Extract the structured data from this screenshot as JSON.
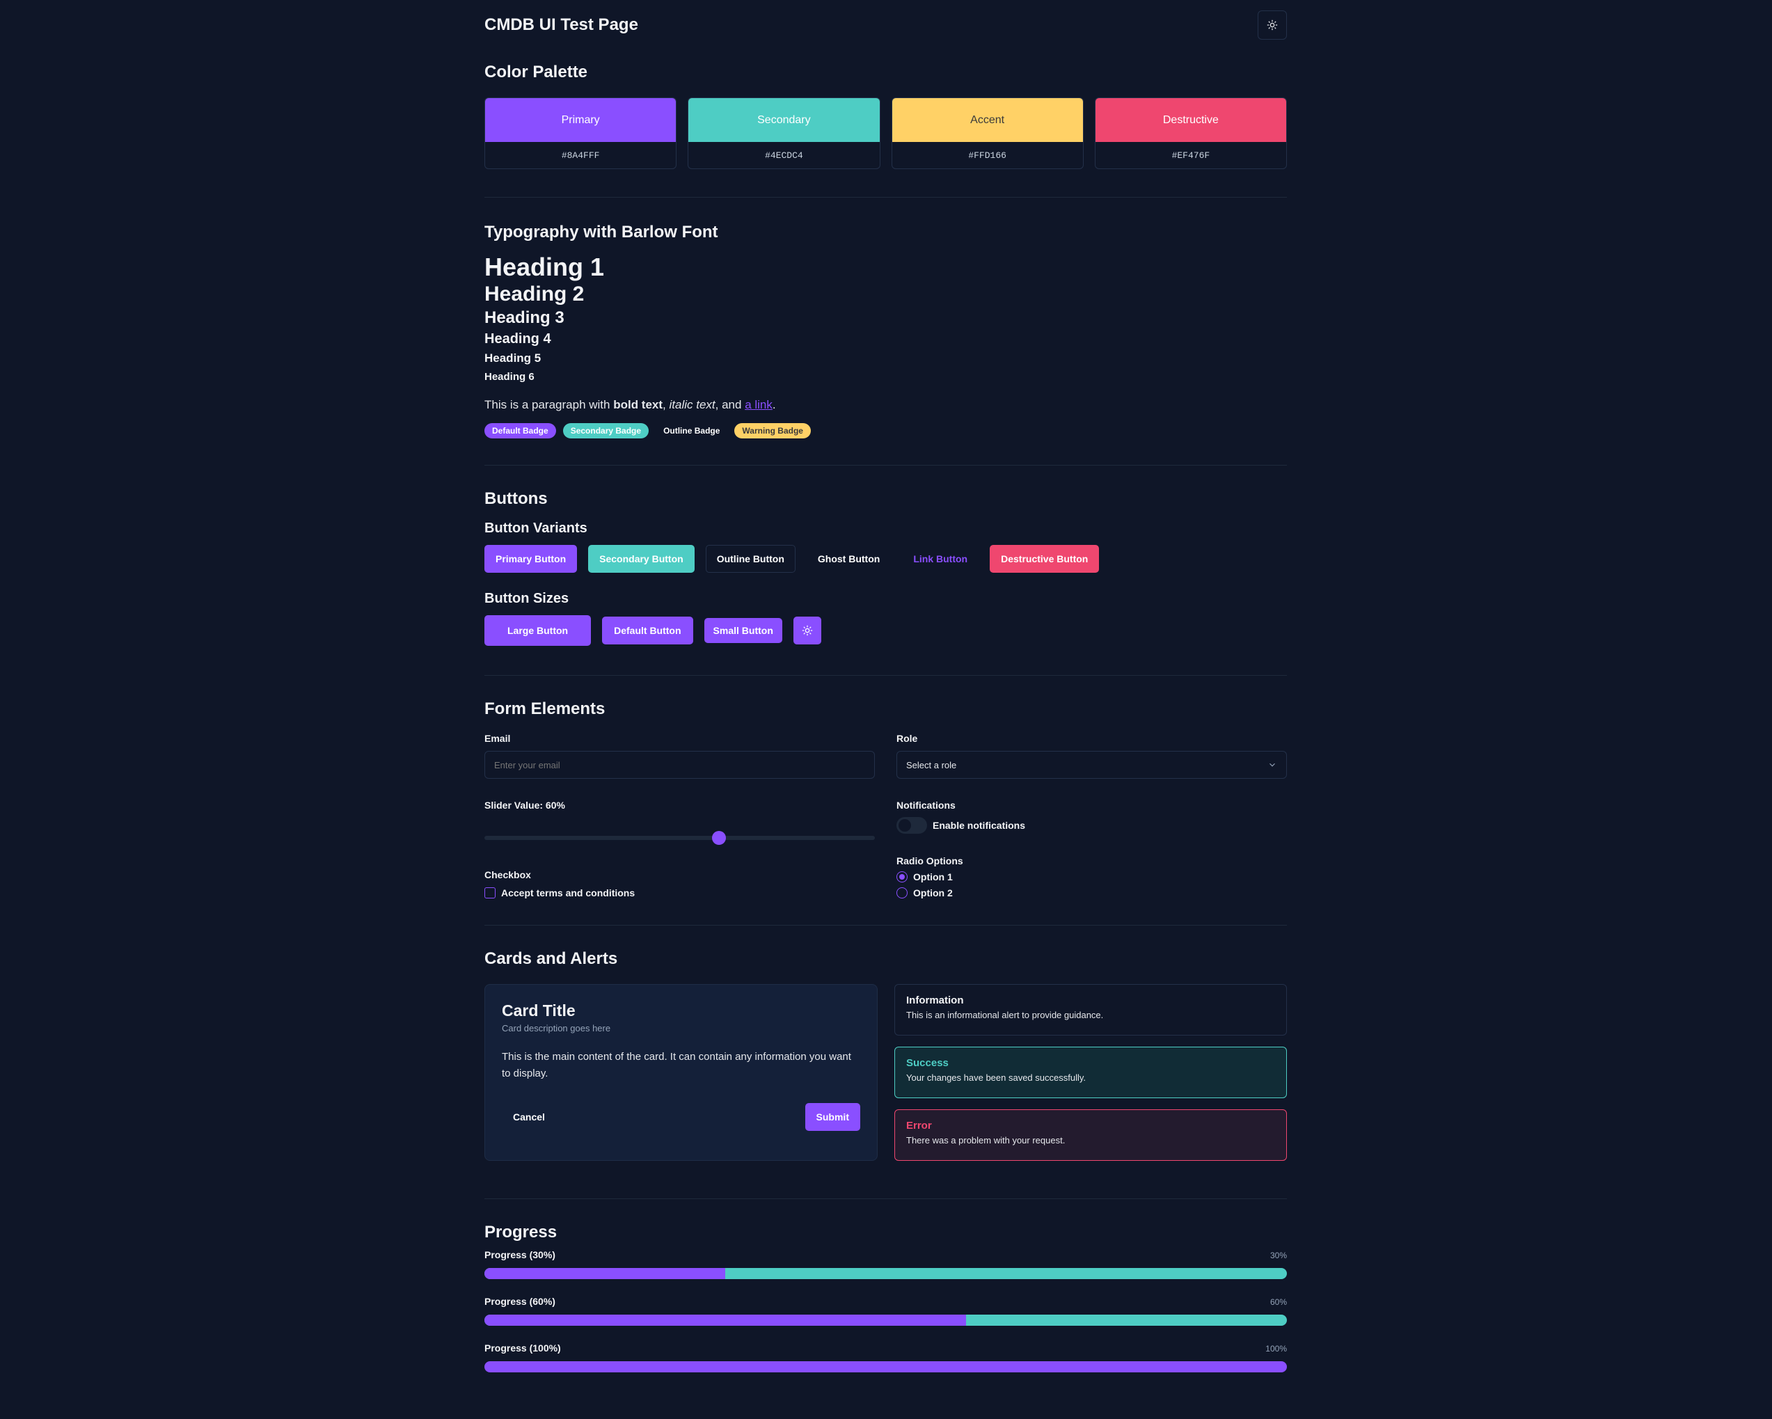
{
  "header": {
    "title": "CMDB UI Test Page",
    "theme_toggle_icon": "sun-icon"
  },
  "palette": {
    "title": "Color Palette",
    "swatches": [
      {
        "name": "Primary",
        "hex": "#8A4FFF",
        "color": "#8a4fff",
        "text_color": "#ffffff"
      },
      {
        "name": "Secondary",
        "hex": "#4ECDC4",
        "color": "#4ecdc4",
        "text_color": "#ffffff"
      },
      {
        "name": "Accent",
        "hex": "#FFD166",
        "color": "#ffd166",
        "text_color": "#3a3a3a"
      },
      {
        "name": "Destructive",
        "hex": "#EF476F",
        "color": "#ef476f",
        "text_color": "#ffffff"
      }
    ]
  },
  "typography": {
    "title": "Typography with Barlow Font",
    "h1": "Heading 1",
    "h2": "Heading 2",
    "h3": "Heading 3",
    "h4": "Heading 4",
    "h5": "Heading 5",
    "h6": "Heading 6",
    "para_prefix": "This is a paragraph with ",
    "para_bold": "bold text",
    "para_sep1": ", ",
    "para_italic": "italic text",
    "para_sep2": ", and ",
    "para_link": "a link",
    "para_end": ".",
    "badges": {
      "default": "Default Badge",
      "secondary": "Secondary Badge",
      "outline": "Outline Badge",
      "warning": "Warning Badge"
    }
  },
  "buttons": {
    "title": "Buttons",
    "variants_title": "Button Variants",
    "primary": "Primary Button",
    "secondary": "Secondary Button",
    "outline": "Outline Button",
    "ghost": "Ghost Button",
    "link": "Link Button",
    "destructive": "Destructive Button",
    "sizes_title": "Button Sizes",
    "large": "Large Button",
    "default": "Default Button",
    "small": "Small Button",
    "icon": "sun-icon"
  },
  "form": {
    "title": "Form Elements",
    "email_label": "Email",
    "email_placeholder": "Enter your email",
    "role_label": "Role",
    "role_value": "Select a role",
    "slider_label": "Slider Value: 60%",
    "slider_value": 60,
    "notifications_label": "Notifications",
    "notifications_toggle_label": "Enable notifications",
    "notifications_enabled": false,
    "checkbox_group_label": "Checkbox",
    "checkbox_label": "Accept terms and conditions",
    "checkbox_checked": false,
    "radio_group_label": "Radio Options",
    "radio_options": [
      "Option 1",
      "Option 2"
    ],
    "radio_selected": "Option 1"
  },
  "cards": {
    "title": "Cards and Alerts",
    "card": {
      "title": "Card Title",
      "description": "Card description goes here",
      "body": "This is the main content of the card. It can contain any information you want to display.",
      "cancel": "Cancel",
      "submit": "Submit"
    },
    "alerts": {
      "info": {
        "title": "Information",
        "text": "This is an informational alert to provide guidance."
      },
      "success": {
        "title": "Success",
        "text": "Your changes have been saved successfully."
      },
      "error": {
        "title": "Error",
        "text": "There was a problem with your request."
      }
    }
  },
  "progress": {
    "title": "Progress",
    "bars": [
      {
        "label": "Progress (30%)",
        "value_text": "30%",
        "value": 30
      },
      {
        "label": "Progress (60%)",
        "value_text": "60%",
        "value": 60
      },
      {
        "label": "Progress (100%)",
        "value_text": "100%",
        "value": 100
      }
    ]
  }
}
